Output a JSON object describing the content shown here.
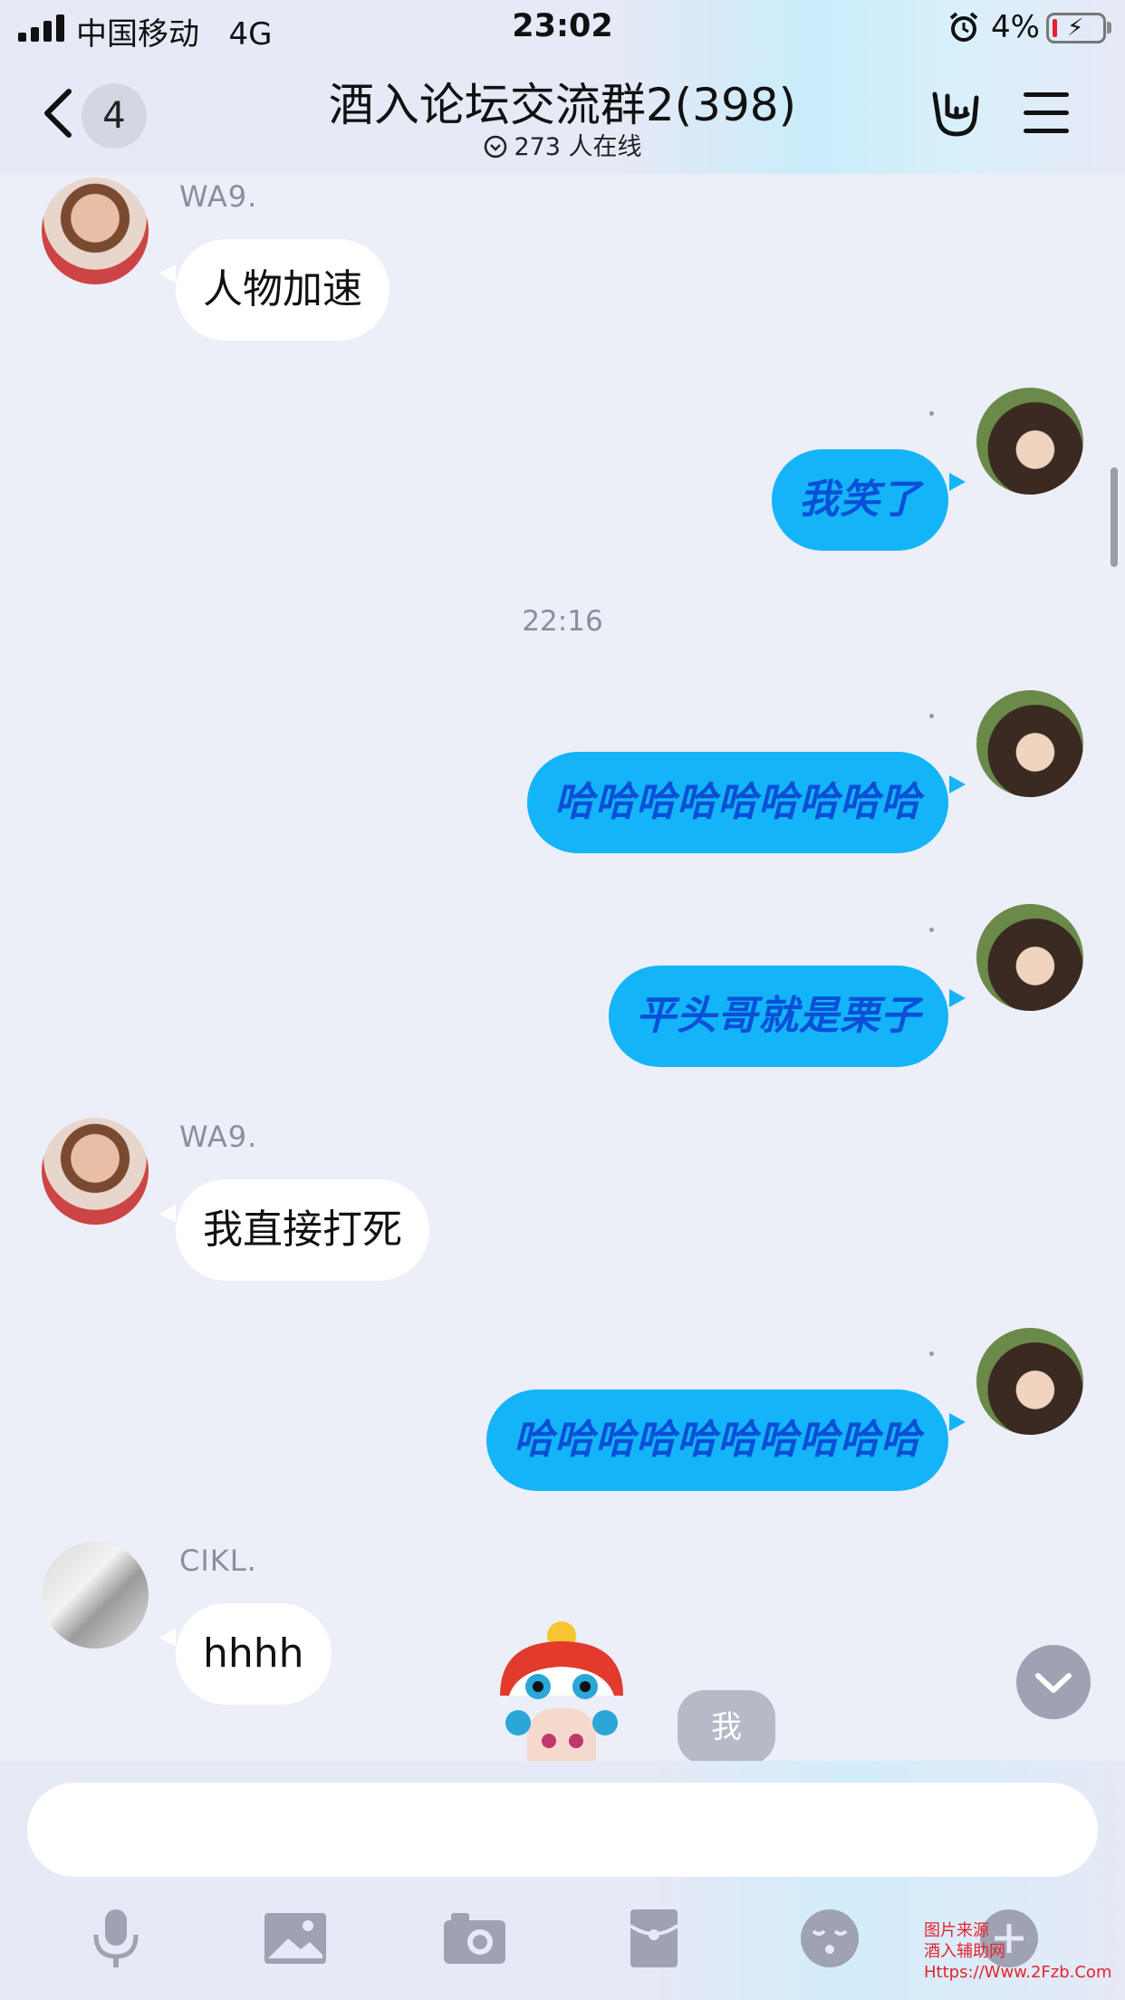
{
  "status_bar": {
    "carrier": "中国移动",
    "network": "4G",
    "time": "23:02",
    "battery": "4%"
  },
  "header": {
    "unread_count": "4",
    "title": "酒入论坛交流群2(398)",
    "online": "273 人在线"
  },
  "messages": [
    {
      "sender": "WA9.",
      "text": "人物加速",
      "direction": "in"
    },
    {
      "text": "我笑了",
      "direction": "out"
    },
    {
      "timestamp": "22:16"
    },
    {
      "text": "哈哈哈哈哈哈哈哈哈",
      "direction": "out"
    },
    {
      "text": "平头哥就是栗子",
      "direction": "out"
    },
    {
      "sender": "WA9.",
      "text": "我直接打死",
      "direction": "in"
    },
    {
      "text": "哈哈哈哈哈哈哈哈哈哈",
      "direction": "out"
    },
    {
      "sender": "CIKL.",
      "text": "hhhh",
      "direction": "in"
    }
  ],
  "overlay": {
    "me_tag": "我"
  },
  "input": {
    "placeholder": ""
  },
  "toolbar": {
    "icons": [
      "microphone-icon",
      "image-icon",
      "camera-icon",
      "red-packet-icon",
      "emoji-icon",
      "plus-icon"
    ]
  },
  "watermark": {
    "line1": "图片来源",
    "line2": "酒入辅助网",
    "line3": "Https://Www.2Fzb.Com"
  },
  "colors": {
    "accent": "#14b4f9",
    "out_text": "#0a4fd6",
    "background": "#eceef8",
    "watermark": "#e2242f"
  }
}
